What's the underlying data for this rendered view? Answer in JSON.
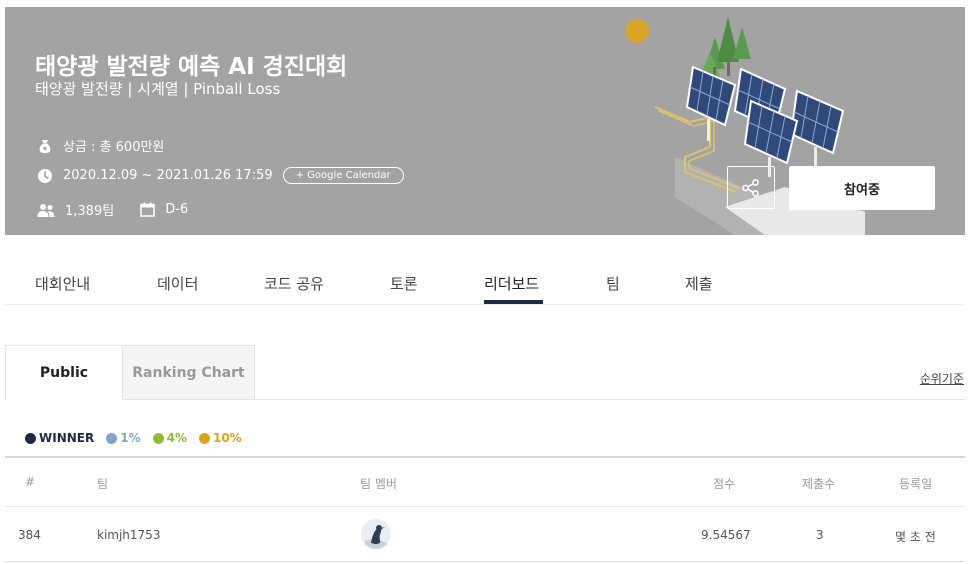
{
  "banner": {
    "title": "태양광 발전량 예측 AI 경진대회",
    "subtitle": "태양광 발전량 | 시계열 | Pinball Loss",
    "prize": "상금 : 총 600만원",
    "period": "2020.12.09 ~ 2021.01.26 17:59",
    "calendar_label": "+ Google Calendar",
    "team_count": "1,389팀",
    "dday": "D-6",
    "join_label": "참여중",
    "icons": [
      "money-bag-icon",
      "clock-icon",
      "people-icon",
      "calendar-icon",
      "share-icon"
    ],
    "background_color": "#a3a3a3"
  },
  "tabs": [
    {
      "label": "대회안내"
    },
    {
      "label": "데이터"
    },
    {
      "label": "코드 공유"
    },
    {
      "label": "토론"
    },
    {
      "label": "리더보드",
      "active": true
    },
    {
      "label": "팀"
    },
    {
      "label": "제출"
    }
  ],
  "subtabs": {
    "public": "Public",
    "chart": "Ranking Chart",
    "rank_basis": "순위기준"
  },
  "legend": [
    {
      "label": "WINNER",
      "color": "#1d2b44"
    },
    {
      "label": "1%",
      "color": "#7ea6cb"
    },
    {
      "label": "4%",
      "color": "#8bbf2d"
    },
    {
      "label": "10%",
      "color": "#e3a11a"
    }
  ],
  "table": {
    "headers": {
      "rank": "#",
      "team": "팀",
      "members": "팀 멤버",
      "score": "점수",
      "submissions": "제출수",
      "date": "등록일"
    },
    "rows": [
      {
        "rank": "384",
        "team": "kimjh1753",
        "score": "9.54567",
        "submissions": "3",
        "date": "몇 초 전"
      }
    ]
  },
  "colors": {
    "accent": "#1d2b44",
    "sun": "#d9a52a",
    "tree": "#5a9a4e"
  }
}
